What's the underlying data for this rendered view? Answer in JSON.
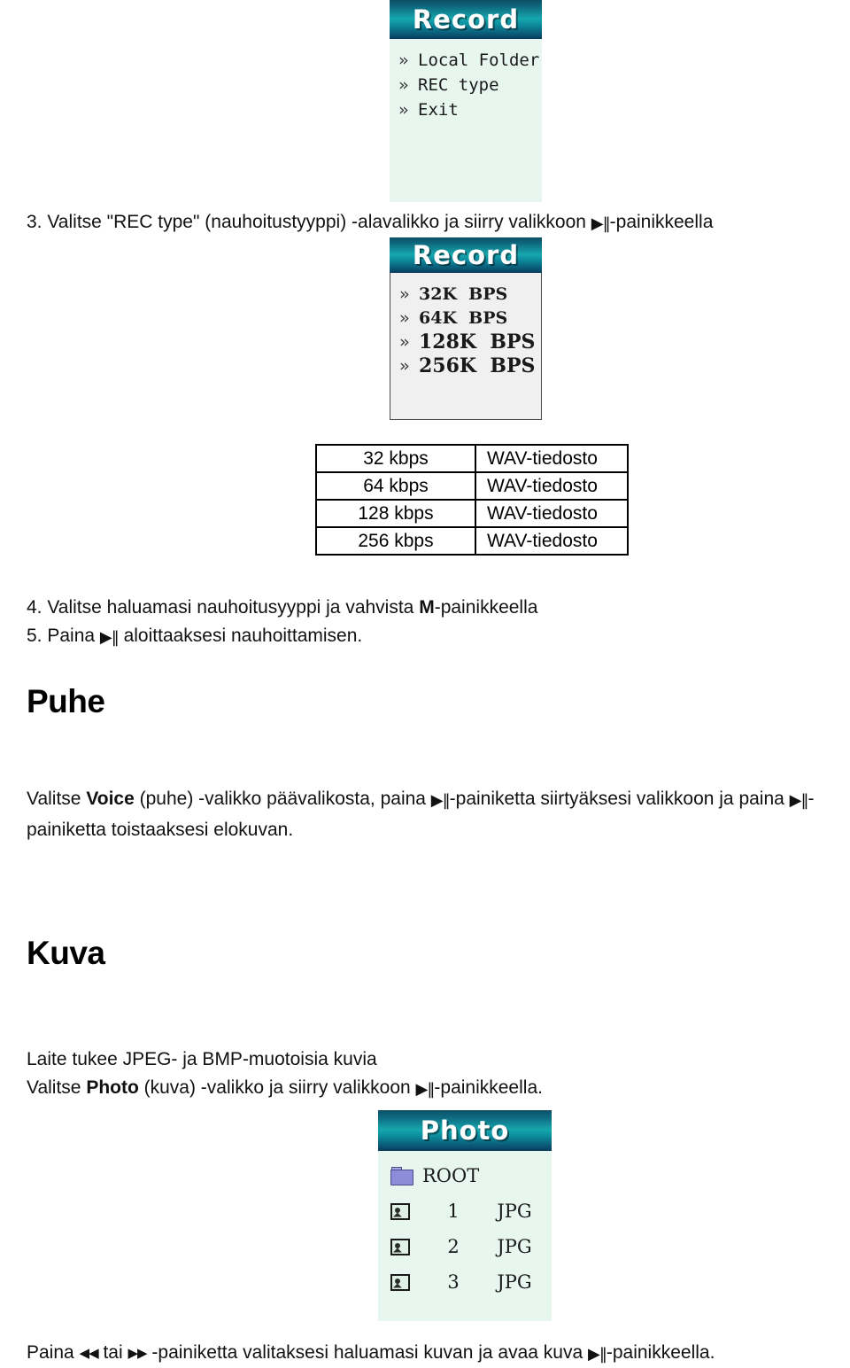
{
  "document": {
    "language": "fi",
    "glyphs": {
      "play_pause": "▶‖",
      "prev": "◀◀",
      "next": "▶▶"
    }
  },
  "screens": {
    "record_main": {
      "title": "Record",
      "items": [
        {
          "arrow": "»",
          "label": "Local Folder"
        },
        {
          "arrow": "»",
          "label": "REC type"
        },
        {
          "arrow": "»",
          "label": "Exit"
        }
      ]
    },
    "record_bitrate": {
      "title": "Record",
      "items": [
        {
          "arrow": "»",
          "label": "32K  BPS"
        },
        {
          "arrow": "»",
          "label": "64K  BPS"
        },
        {
          "arrow": "»",
          "label": "128K  BPS"
        },
        {
          "arrow": "»",
          "label": "256K  BPS"
        }
      ]
    },
    "photo": {
      "title": "Photo",
      "root_label": "ROOT",
      "files": [
        {
          "name": "1",
          "ext": "JPG"
        },
        {
          "name": "2",
          "ext": "JPG"
        },
        {
          "name": "3",
          "ext": "JPG"
        }
      ]
    }
  },
  "steps": {
    "step3_prefix": "3. ",
    "step3_text_before": "Valitse \"REC type\" (nauhoitustyyppi) -alavalikko ja siirry valikkoon ",
    "step3_text_after": "-painikkeella",
    "step4": "4. Valitse haluamasi nauhoitusyyppi ja vahvista ",
    "step4_bold": "M",
    "step4_after": "-painikkeella",
    "step5_before": "5. Paina ",
    "step5_after": " aloittaaksesi nauhoittamisen."
  },
  "bitrate_table": {
    "rows": [
      {
        "rate": "32 kbps",
        "file": "WAV-tiedosto"
      },
      {
        "rate": "64 kbps",
        "file": "WAV-tiedosto"
      },
      {
        "rate": "128 kbps",
        "file": "WAV-tiedosto"
      },
      {
        "rate": "256 kbps",
        "file": "WAV-tiedosto"
      }
    ]
  },
  "voice_section": {
    "heading": "Puhe",
    "p_a": "Valitse ",
    "p_bold": "Voice",
    "p_b": " (puhe) -valikko päävalikosta, paina ",
    "p_c": "-painiketta siirtyäksesi valikkoon ja paina ",
    "p_d": "-painiketta toistaaksesi elokuvan."
  },
  "image_section": {
    "heading": "Kuva",
    "line1": "Laite tukee JPEG- ja BMP-muotoisia kuvia",
    "line2_a": "Valitse ",
    "line2_bold": "Photo",
    "line2_b": " (kuva) -valikko ja siirry valikkoon ",
    "line2_c": "-painikkeella.",
    "footer_a": "Paina ",
    "footer_b": " tai ",
    "footer_c": " -painiketta valitaksesi haluamasi kuvan ja avaa kuva ",
    "footer_d": "-painikkeella."
  }
}
